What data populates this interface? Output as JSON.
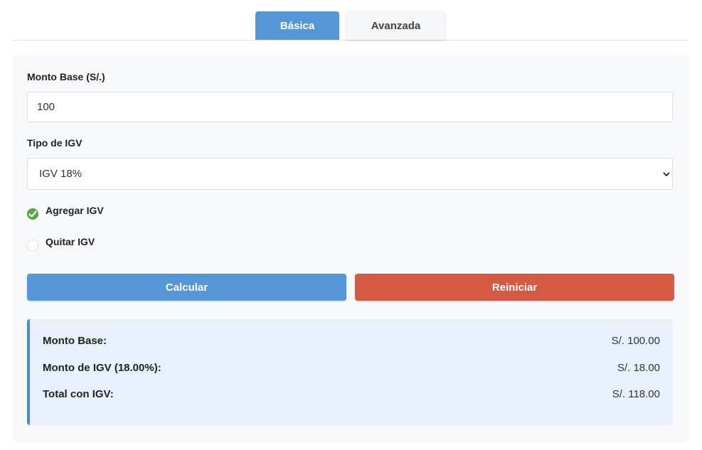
{
  "tabs": {
    "basic": "Básica",
    "advanced": "Avanzada"
  },
  "form": {
    "amount_label": "Monto Base (S/.)",
    "amount_value": "100",
    "igv_type_label": "Tipo de IGV",
    "igv_type_selected": "IGV 18%",
    "options": [
      {
        "label": "Agregar IGV",
        "checked": true
      },
      {
        "label": "Quitar IGV",
        "checked": false
      }
    ]
  },
  "buttons": {
    "calculate": "Calcular",
    "reset": "Reiniciar"
  },
  "results": {
    "rows": [
      {
        "label": "Monto Base:",
        "value": "S/. 100.00"
      },
      {
        "label": "Monto de IGV (18.00%):",
        "value": "S/. 18.00"
      },
      {
        "label": "Total con IGV:",
        "value": "S/. 118.00"
      }
    ]
  },
  "colors": {
    "primary": "#5596d6",
    "danger": "#d45a43",
    "check": "#5aa33e",
    "result_bg": "#e8f1fb"
  }
}
